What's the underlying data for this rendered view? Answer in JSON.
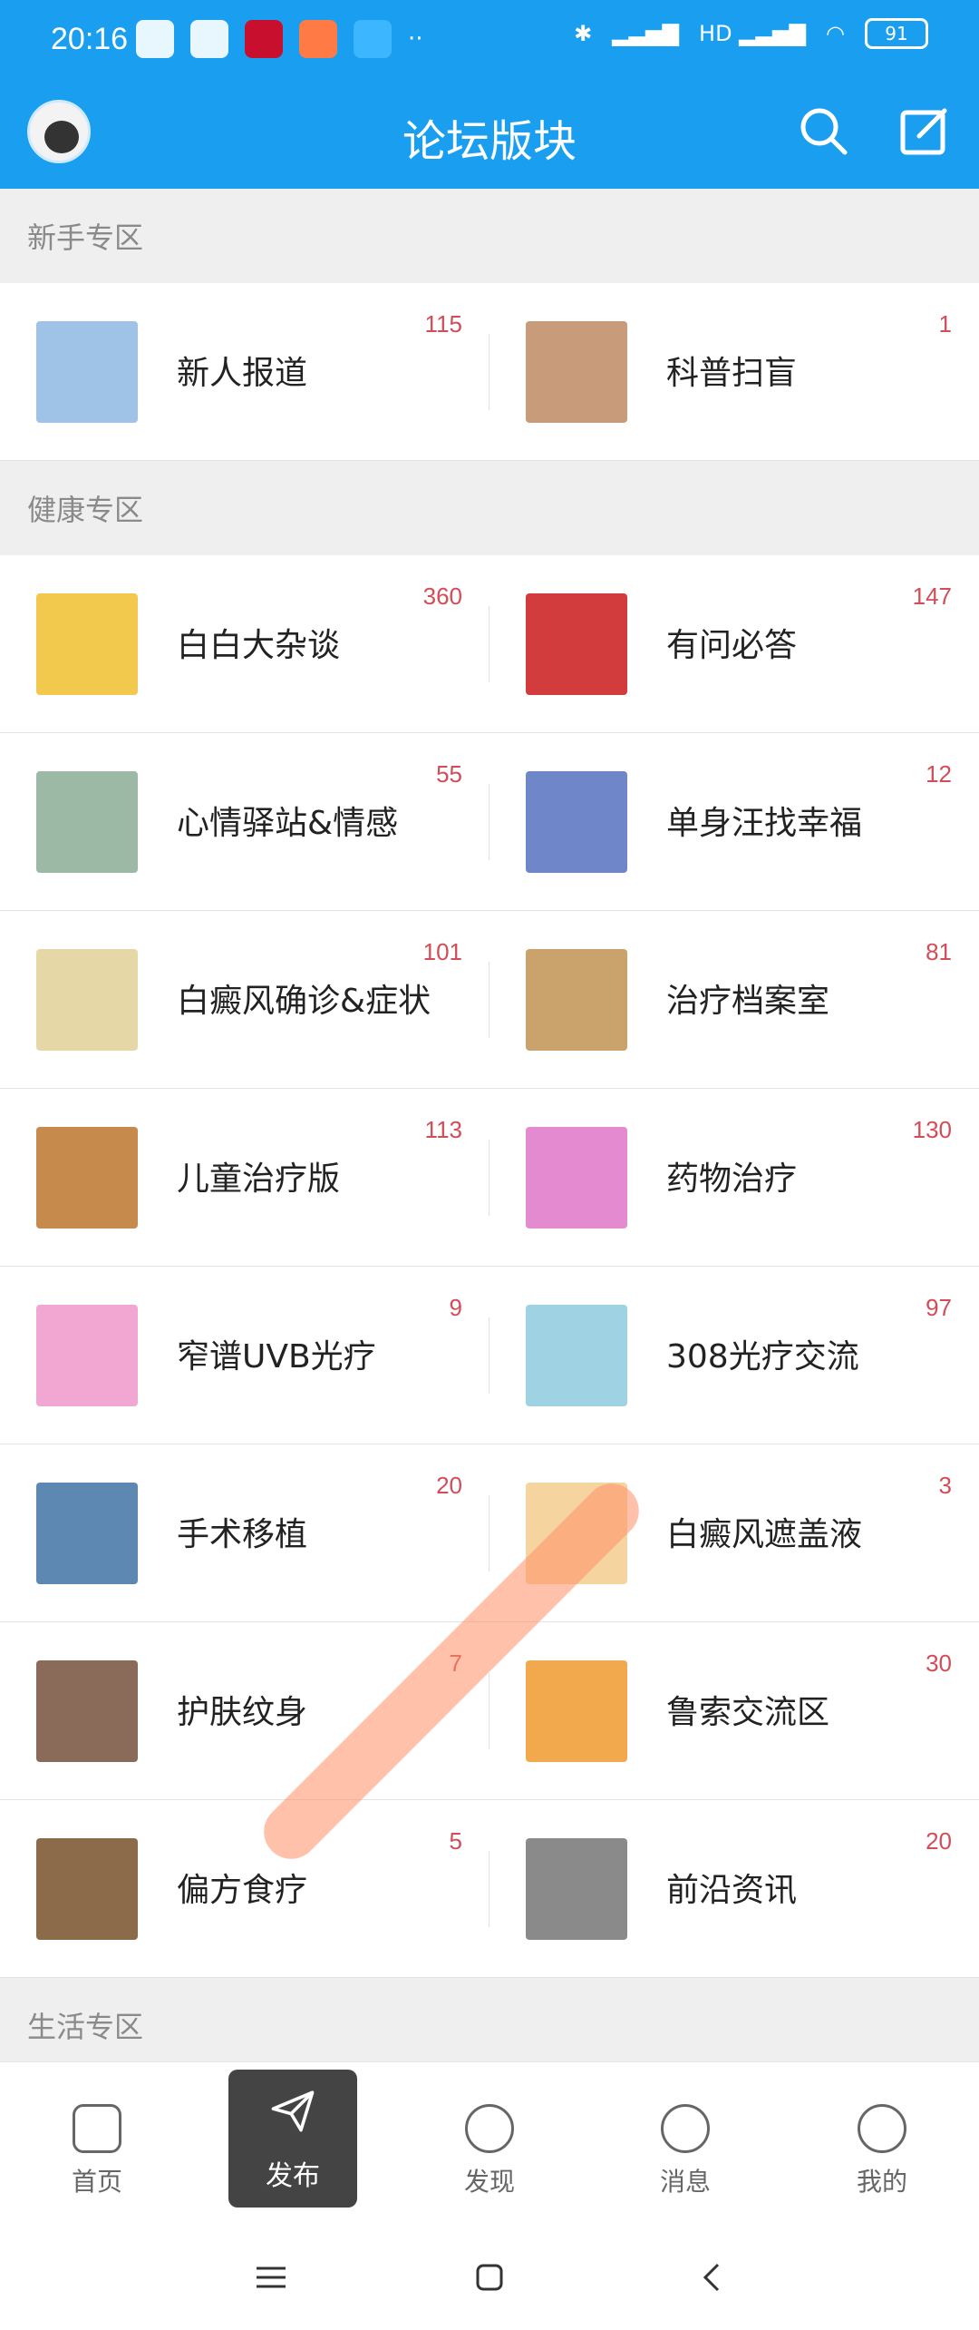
{
  "status": {
    "time": "20:16",
    "hd": "HD",
    "battery": "91"
  },
  "header": {
    "title": "论坛版块"
  },
  "sections": [
    {
      "title": "新手专区",
      "items": [
        {
          "label": "新人报道",
          "count": "115",
          "color": "#9ec3e6"
        },
        {
          "label": "科普扫盲",
          "count": "1",
          "color": "#c89b7b"
        }
      ]
    },
    {
      "title": "健康专区",
      "items": [
        {
          "label": "白白大杂谈",
          "count": "360",
          "color": "#f2c94c"
        },
        {
          "label": "有问必答",
          "count": "147",
          "color": "#d33c3c"
        },
        {
          "label": "心情驿站&情感",
          "count": "55",
          "color": "#9bb9a4"
        },
        {
          "label": "单身汪找幸福",
          "count": "12",
          "color": "#6f86c9"
        },
        {
          "label": "白癜风确诊&症状",
          "count": "101",
          "color": "#e6d8a6"
        },
        {
          "label": "治疗档案室",
          "count": "81",
          "color": "#c9a36b"
        },
        {
          "label": "儿童治疗版",
          "count": "113",
          "color": "#c58a4c"
        },
        {
          "label": "药物治疗",
          "count": "130",
          "color": "#e38ad0"
        },
        {
          "label": "窄谱UVB光疗",
          "count": "9",
          "color": "#f2a7d3"
        },
        {
          "label": "308光疗交流",
          "count": "97",
          "color": "#9fd3e4"
        },
        {
          "label": "手术移植",
          "count": "20",
          "color": "#5d88b2"
        },
        {
          "label": "白癜风遮盖液",
          "count": "3",
          "color": "#f6d4a0"
        },
        {
          "label": "护肤纹身",
          "count": "7",
          "color": "#8a6b5a"
        },
        {
          "label": "鲁索交流区",
          "count": "30",
          "color": "#f2a84c"
        },
        {
          "label": "偏方食疗",
          "count": "5",
          "color": "#8c6b4a"
        },
        {
          "label": "前沿资讯",
          "count": "20",
          "color": "#8a8a8a"
        }
      ]
    },
    {
      "title": "生活专区",
      "items": []
    }
  ],
  "bottom_nav": {
    "home": "首页",
    "publish": "发布",
    "discover": "发现",
    "messages": "消息",
    "mine": "我的"
  }
}
